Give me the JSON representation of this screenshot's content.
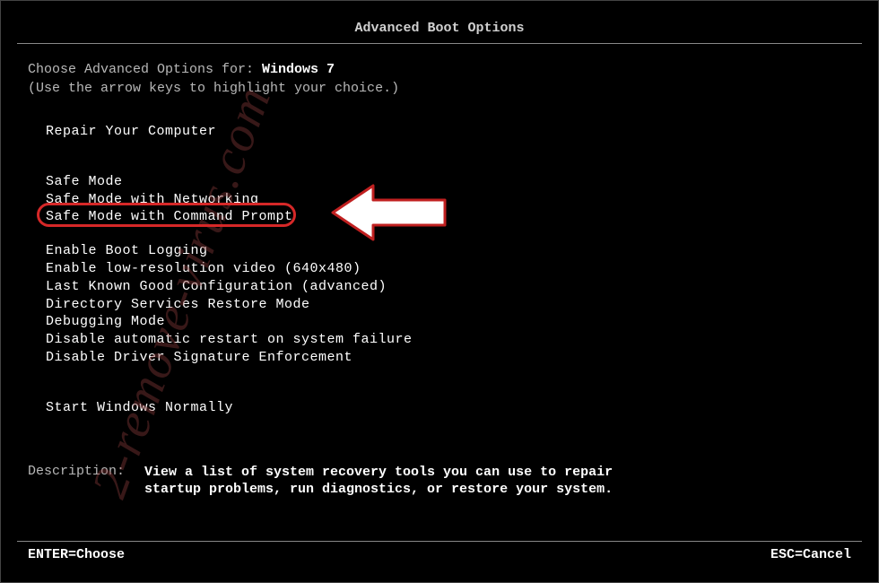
{
  "title": "Advanced Boot Options",
  "intro_prefix": "Choose Advanced Options for: ",
  "os_version": "Windows 7",
  "hint": "(Use the arrow keys to highlight your choice.)",
  "menu": {
    "group1": [
      "Repair Your Computer"
    ],
    "group2": [
      "Safe Mode",
      "Safe Mode with Networking",
      "Safe Mode with Command Prompt"
    ],
    "group3": [
      "Enable Boot Logging",
      "Enable low-resolution video (640x480)",
      "Last Known Good Configuration (advanced)",
      "Directory Services Restore Mode",
      "Debugging Mode",
      "Disable automatic restart on system failure",
      "Disable Driver Signature Enforcement"
    ],
    "group4": [
      "Start Windows Normally"
    ]
  },
  "highlighted_item": "Safe Mode with Command Prompt",
  "description": {
    "label": "Description:",
    "text_line1": "View a list of system recovery tools you can use to repair",
    "text_line2": "startup problems, run diagnostics, or restore your system."
  },
  "footer": {
    "enter": "ENTER=Choose",
    "esc": "ESC=Cancel"
  },
  "watermark": "2-remove-virus.com"
}
